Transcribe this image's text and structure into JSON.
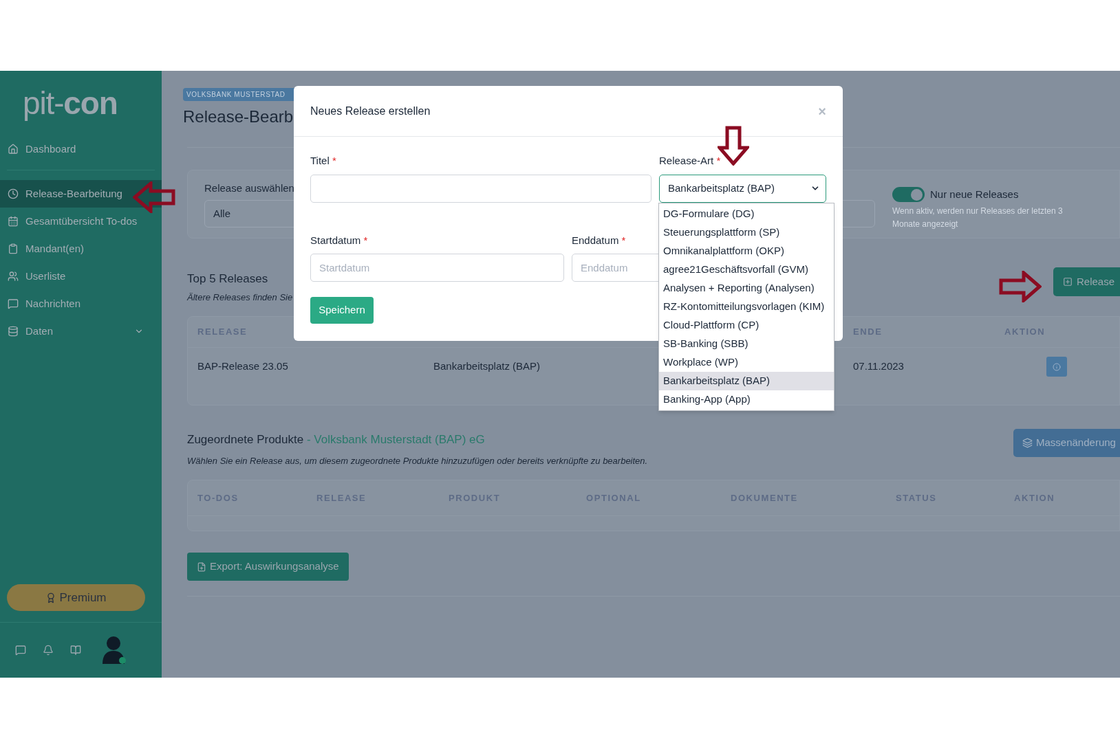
{
  "sidebar": {
    "logo": {
      "light": "pit-",
      "bold": "con"
    },
    "items": [
      {
        "label": "Dashboard",
        "selected": false
      },
      {
        "label": "Release-Bearbeitung",
        "selected": true
      },
      {
        "label": "Gesamtübersicht To-dos",
        "selected": false
      },
      {
        "label": "Mandant(en)",
        "selected": false
      },
      {
        "label": "Userliste",
        "selected": false
      },
      {
        "label": "Nachrichten",
        "selected": false
      },
      {
        "label": "Daten",
        "selected": false
      }
    ],
    "premium": "Premium"
  },
  "page": {
    "badge": "VOLKSBANK MUSTERSTAD",
    "title": "Release-Bearb",
    "filter": {
      "label": "Release auswählen",
      "value": "Alle",
      "toggle": {
        "on": true,
        "label": "Nur neue Releases",
        "hint": "Wenn aktiv, werden nur Releases der letzten 3 Monate angezeigt"
      }
    },
    "top_releases": {
      "title": "Top 5 Releases",
      "subtitle": "Ältere Releases finden Sie",
      "button": "Release",
      "columns": [
        "RELEASE",
        "",
        "ENDE",
        "AKTION"
      ],
      "rows": [
        {
          "cells": [
            "BAP-Release 23.05",
            "Bankarbeitsplatz (BAP)",
            "07.11.2023"
          ]
        }
      ]
    },
    "products": {
      "title": "Zugeordnete Produkte",
      "title_suffix": " - Volksbank Musterstadt (BAP) eG",
      "subtitle": "Wählen Sie ein Release aus, um diesem zugeordnete Produkte hinzuzufügen oder bereits verknüpfte zu bearbeiten.",
      "button": "Massenänderung",
      "columns": [
        "TO-DOS",
        "RELEASE",
        "PRODUKT",
        "OPTIONAL",
        "DOKUMENTE",
        "STATUS",
        "AKTION"
      ]
    },
    "export_button": "Export: Auswirkungsanalyse"
  },
  "modal": {
    "title": "Neues Release erstellen",
    "close": "×",
    "required_mark": "*",
    "fields": [
      {
        "label": "Titel"
      },
      {
        "label": "Startdatum",
        "placeholder": "Startdatum"
      },
      {
        "label": "Enddatum",
        "placeholder": "Enddatum"
      }
    ],
    "select": {
      "label": "Release-Art",
      "value": "Bankarbeitsplatz (BAP)",
      "options": [
        {
          "label": "DG-Formulare (DG)",
          "selected": false
        },
        {
          "label": "Steuerungsplattform (SP)",
          "selected": false
        },
        {
          "label": "Omnikanalplattform (OKP)",
          "selected": false
        },
        {
          "label": "agree21Geschäftsvorfall (GVM)",
          "selected": false
        },
        {
          "label": "Analysen + Reporting (Analysen)",
          "selected": false
        },
        {
          "label": "RZ-Kontomitteilungsvorlagen (KIM)",
          "selected": false
        },
        {
          "label": "Cloud-Plattform (CP)",
          "selected": false
        },
        {
          "label": "SB-Banking (SBB)",
          "selected": false
        },
        {
          "label": "Workplace (WP)",
          "selected": false
        },
        {
          "label": "Bankarbeitsplatz (BAP)",
          "selected": true
        },
        {
          "label": "Banking-App (App)",
          "selected": false
        }
      ]
    },
    "save": "Speichern"
  }
}
